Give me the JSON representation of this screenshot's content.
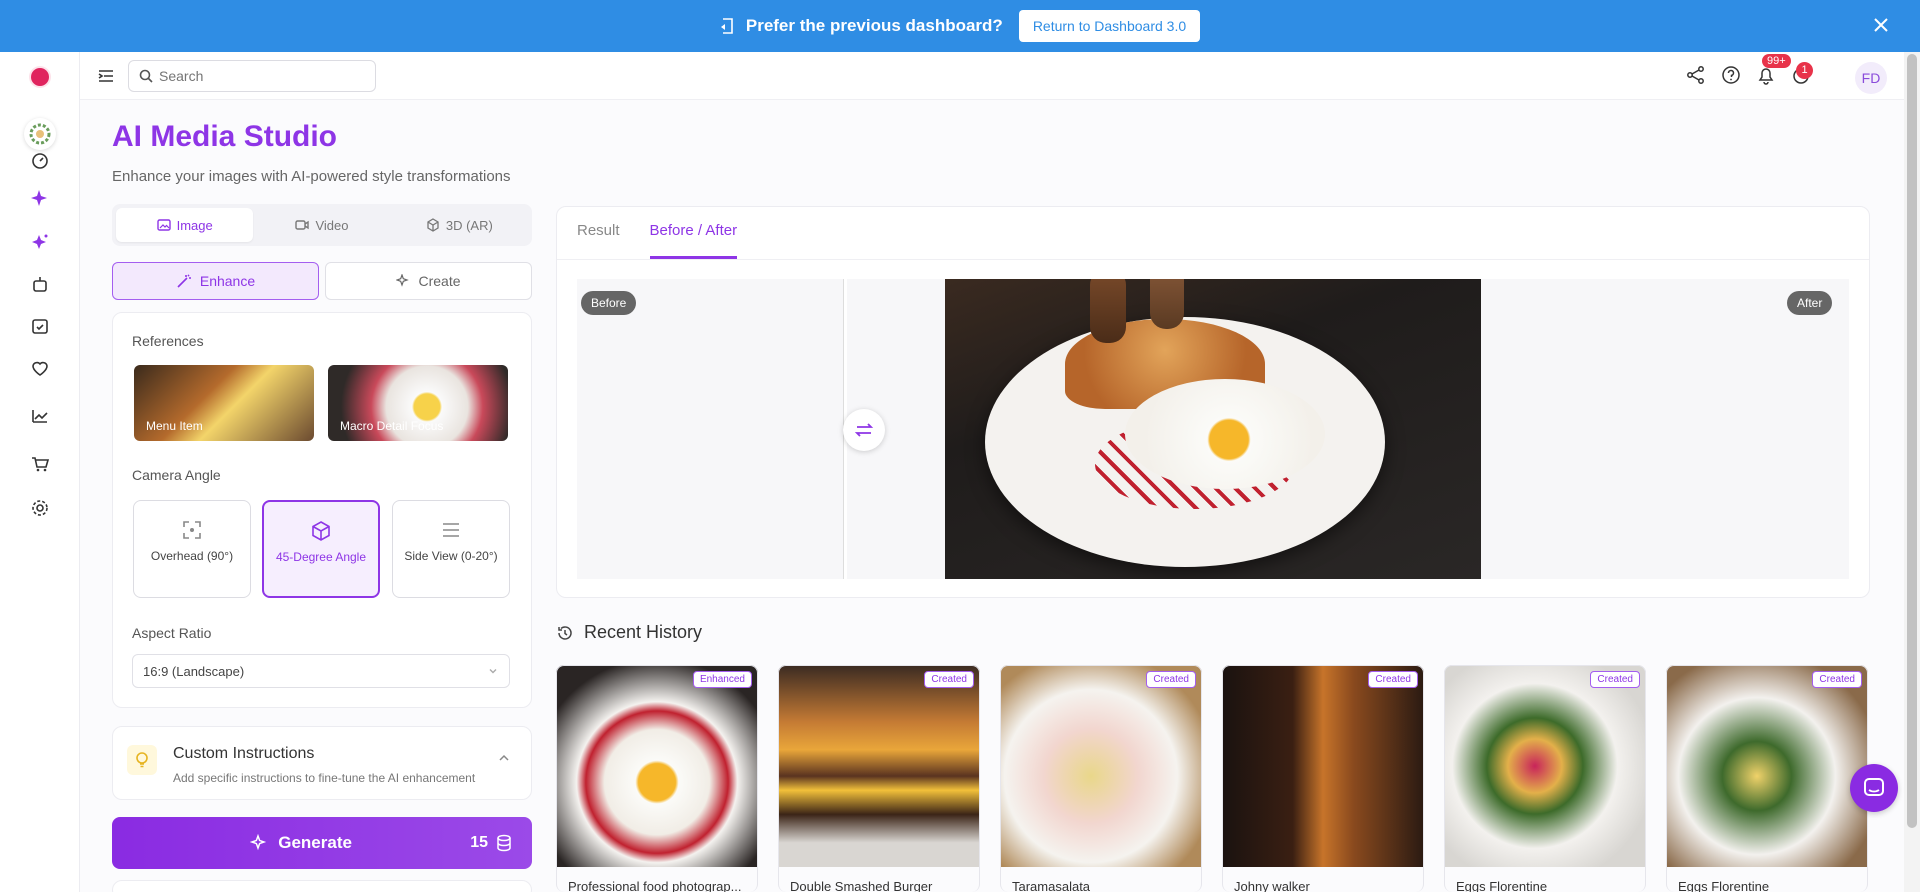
{
  "banner": {
    "message": "Prefer the previous dashboard?",
    "button": "Return to Dashboard 3.0"
  },
  "header": {
    "search_placeholder": "Search",
    "notification_count": "99+",
    "alert_count": "1",
    "avatar_initials": "FD"
  },
  "page": {
    "title": "AI Media Studio",
    "subtitle": "Enhance your images with AI-powered style transformations"
  },
  "media_tabs": [
    {
      "label": "Image",
      "icon": "image-icon",
      "active": true
    },
    {
      "label": "Video",
      "icon": "video-icon"
    },
    {
      "label": "3D (AR)",
      "icon": "cube-icon"
    }
  ],
  "mode": {
    "enhance": "Enhance",
    "create": "Create"
  },
  "references": {
    "label": "References",
    "items": [
      {
        "label": "Menu Item"
      },
      {
        "label": "Macro Detail Focus"
      }
    ]
  },
  "camera_angle": {
    "label": "Camera Angle",
    "options": [
      {
        "label": "Overhead (90°)"
      },
      {
        "label": "45-Degree Angle",
        "active": true
      },
      {
        "label": "Side View (0-20°)"
      }
    ]
  },
  "aspect_ratio": {
    "label": "Aspect Ratio",
    "value": "16:9 (Landscape)"
  },
  "custom_instructions": {
    "title": "Custom Instructions",
    "subtitle": "Add specific instructions to fine-tune the AI enhancement"
  },
  "generate": {
    "label": "Generate",
    "credits": "15"
  },
  "preview": {
    "tabs": [
      {
        "label": "Result"
      },
      {
        "label": "Before / After",
        "active": true
      }
    ],
    "before_label": "Before",
    "after_label": "After"
  },
  "history": {
    "title": "Recent History",
    "items": [
      {
        "tag": "Enhanced",
        "name": "Professional food photograp..."
      },
      {
        "tag": "Created",
        "name": "Double Smashed Burger"
      },
      {
        "tag": "Created",
        "name": "Taramasalata"
      },
      {
        "tag": "Created",
        "name": "Johny walker"
      },
      {
        "tag": "Created",
        "name": "Eggs Florentine"
      },
      {
        "tag": "Created",
        "name": "Eggs Florentine"
      }
    ]
  },
  "colors": {
    "accent": "#8e35e6",
    "banner": "#2f8de4",
    "badge": "#e8334a"
  }
}
